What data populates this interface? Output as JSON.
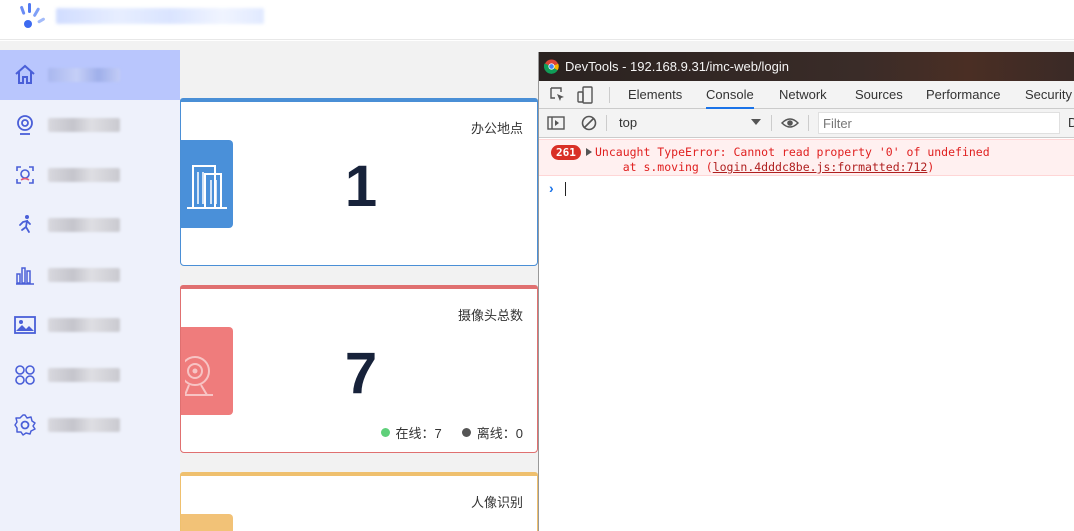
{
  "colors": {
    "sidebar_active": "#b9c6fd",
    "card_blue": "#4a90d9",
    "card_red": "#ef7c7c",
    "card_yellow": "#f2c277",
    "online": "#5fd07a",
    "offline": "#555555",
    "error_text": "#e02020",
    "error_badge": "#d93026",
    "tab_active_underline": "#1a73e8"
  },
  "sidebar": {
    "items": [
      {
        "icon": "home-icon",
        "label": "首页"
      },
      {
        "icon": "webcam-icon",
        "label": "视频"
      },
      {
        "icon": "face-icon",
        "label": ""
      },
      {
        "icon": "running-person-icon",
        "label": ""
      },
      {
        "icon": "bar-chart-icon",
        "label": ""
      },
      {
        "icon": "image-icon",
        "label": ""
      },
      {
        "icon": "apps-icon",
        "label": ""
      },
      {
        "icon": "gear-icon",
        "label": ""
      }
    ]
  },
  "cards": {
    "office": {
      "title": "办公地点",
      "value": "1",
      "icon": "building-icon"
    },
    "cameras": {
      "title": "摄像头总数",
      "value": "7",
      "icon": "camera-icon",
      "online_label": "在线：7",
      "offline_label": "离线：0"
    },
    "face": {
      "title": "人像识别",
      "icon": "portrait-icon"
    }
  },
  "devtools": {
    "title": "DevTools - 192.168.9.31/imc-web/login",
    "tabs": [
      "Elements",
      "Console",
      "Network",
      "Sources",
      "Performance",
      "Security"
    ],
    "active_tab": "Console",
    "context": "top",
    "filter_placeholder": "Filter",
    "clipped_char": "D",
    "error": {
      "count": "261",
      "line1": "Uncaught TypeError: Cannot read property '0' of undefined",
      "line2_prefix": "    at s.moving (",
      "link": "login.4dddc8be.js:formatted:712",
      "line2_suffix": ")"
    },
    "prompt": "›"
  }
}
